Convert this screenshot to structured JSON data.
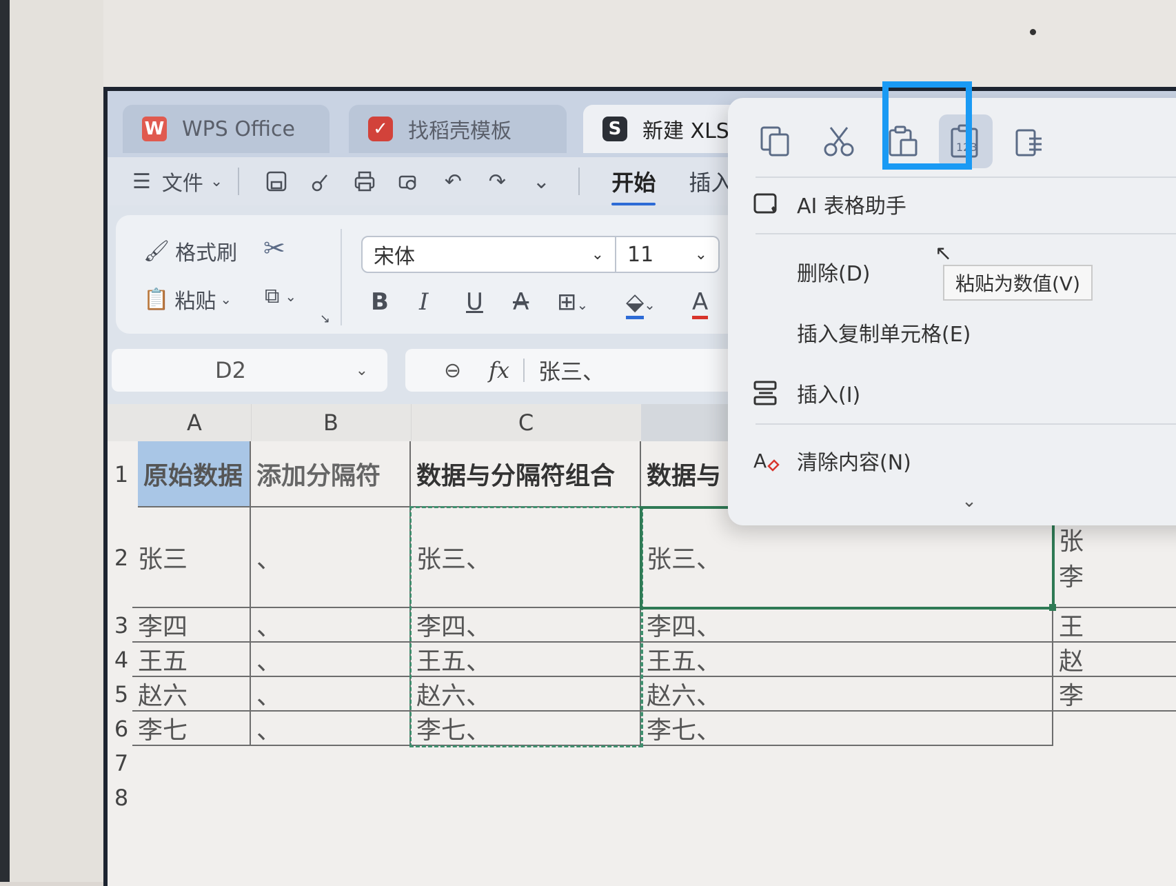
{
  "titlebar": {
    "tabs": [
      {
        "label": "WPS Office",
        "icon": "W"
      },
      {
        "label": "找稻壳模板",
        "icon": "✓"
      },
      {
        "label": "新建 XLSX 工作",
        "icon": "S"
      }
    ]
  },
  "menubar": {
    "file_label": "文件",
    "tabs": [
      "开始",
      "插入"
    ]
  },
  "ribbon": {
    "format_painter": "格式刷",
    "paste": "粘贴",
    "font_name": "宋体",
    "font_size": "11",
    "bold": "B",
    "italic": "I",
    "underline": "U",
    "strike": "A",
    "font_color_letter": "A"
  },
  "formula_bar": {
    "cell_ref": "D2",
    "fx": "fx",
    "content": "张三、"
  },
  "sheet": {
    "columns": [
      "A",
      "B",
      "C"
    ],
    "rows": [
      "1",
      "2",
      "3",
      "4",
      "5",
      "6",
      "7",
      "8"
    ],
    "header": [
      "原始数据",
      "添加分隔符",
      "数据与分隔符组合",
      "数据与"
    ],
    "data": [
      [
        "张三",
        "、",
        "张三、",
        "张三、",
        "张"
      ],
      [
        "李四",
        "、",
        "李四、",
        "李四、",
        "王"
      ],
      [
        "王五",
        "、",
        "王五、",
        "王五、",
        "赵"
      ],
      [
        "赵六",
        "、",
        "赵六、",
        "赵六、",
        "李"
      ],
      [
        "李七",
        "、",
        "李七、",
        "李七、",
        ""
      ]
    ],
    "row2_extra": "李"
  },
  "context_menu": {
    "ai_assistant": "AI 表格助手",
    "delete": "删除(D)",
    "insert_copied": "插入复制单元格(E)",
    "insert": "插入(I)",
    "clear": "清除内容(N)",
    "tooltip": "粘贴为数值(V)"
  },
  "colors": {
    "highlight": "#1a9af4",
    "selection": "#2f7a55",
    "header_a_bg": "#a9c6e6"
  }
}
